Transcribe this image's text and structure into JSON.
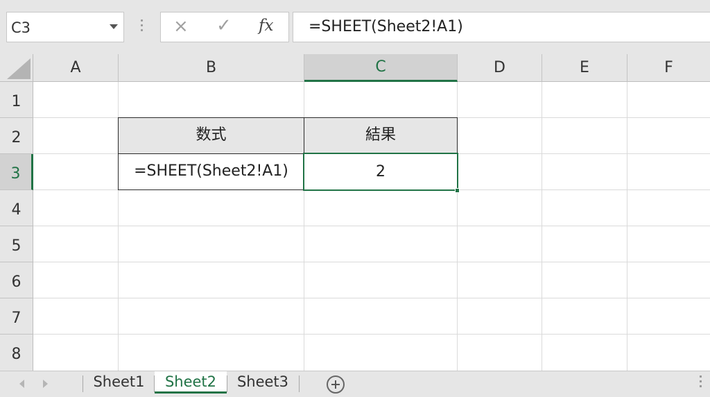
{
  "formula_bar": {
    "name_box": "C3",
    "cancel_icon": "×",
    "enter_icon": "✓",
    "fx_label": "fx",
    "formula": "=SHEET(Sheet2!A1)"
  },
  "columns": [
    "A",
    "B",
    "C",
    "D",
    "E",
    "F"
  ],
  "rows": [
    "1",
    "2",
    "3",
    "4",
    "5",
    "6",
    "7",
    "8"
  ],
  "selected_cell": "C3",
  "table": {
    "header_formula": "数式",
    "header_result": "結果",
    "formula_text": "=SHEET(Sheet2!A1)",
    "result_value": "2"
  },
  "sheet_tabs": [
    "Sheet1",
    "Sheet2",
    "Sheet3"
  ],
  "active_sheet": "Sheet2",
  "colors": {
    "accent": "#217346",
    "header_bg": "#e6e6e6",
    "gridline": "#dadada"
  }
}
